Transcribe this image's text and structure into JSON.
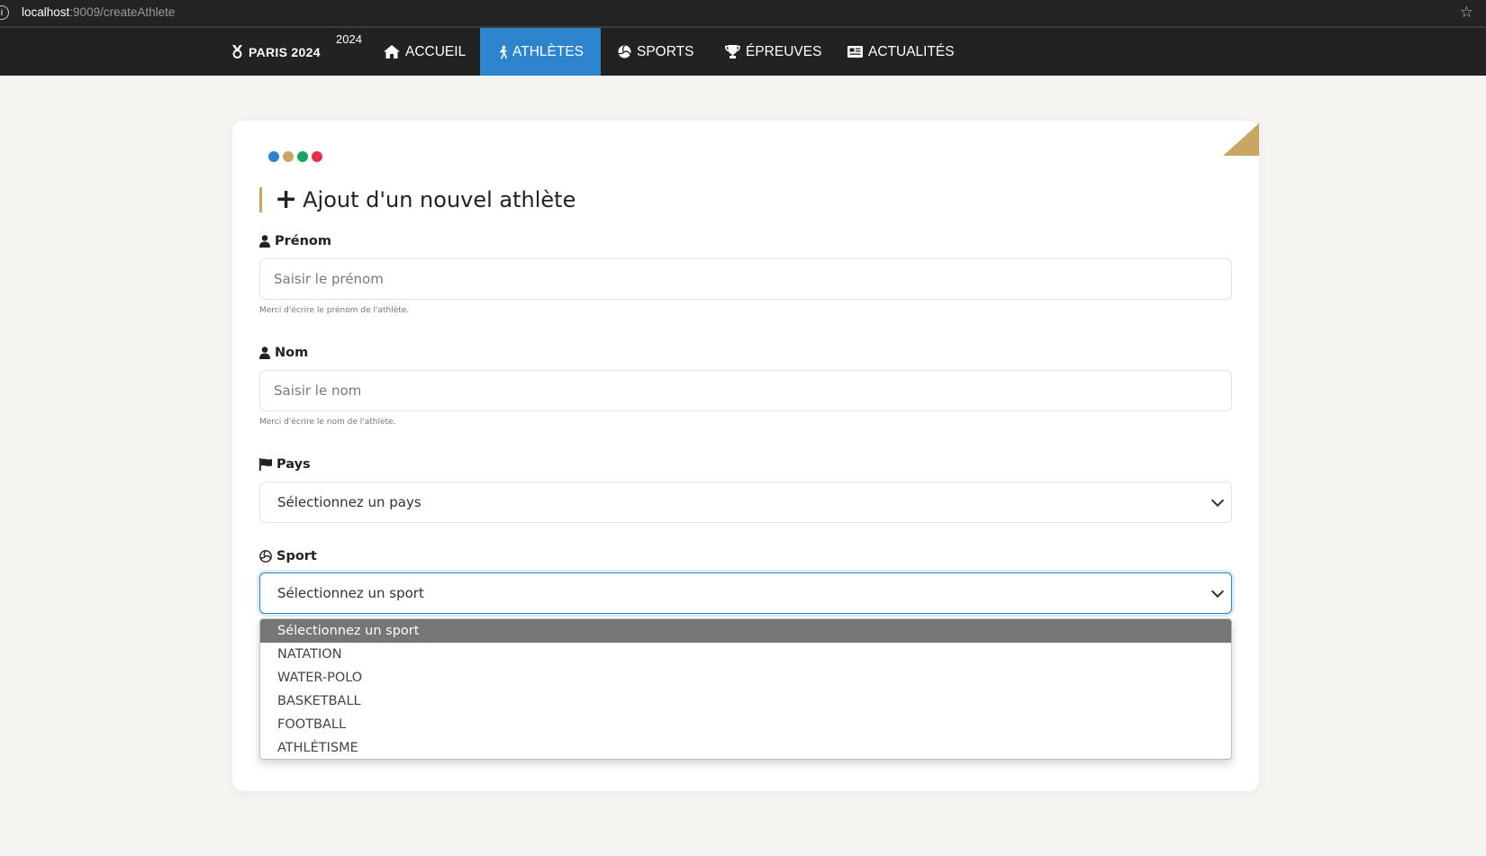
{
  "browser": {
    "url_host": "localhost",
    "url_path": ":9009/createAthlete"
  },
  "nav": {
    "brand": "PARIS 2024",
    "brand_year": "2024",
    "items": [
      {
        "label": "ACCUEIL",
        "icon": "home-icon",
        "active": false
      },
      {
        "label": "ATHLÈTES",
        "icon": "running-icon",
        "active": true
      },
      {
        "label": "SPORTS",
        "icon": "volleyball-icon",
        "active": false
      },
      {
        "label": "ÉPREUVES",
        "icon": "trophy-icon",
        "active": false
      },
      {
        "label": "ACTUALITÉS",
        "icon": "newspaper-icon",
        "active": false
      }
    ],
    "active_color": "#2b84cc"
  },
  "form": {
    "title": "Ajout d'un nouvel athlète",
    "dots_colors": [
      "#2b84cc",
      "#c9a661",
      "#1aa260",
      "#e0334a"
    ],
    "accent_color": "#c9a661",
    "prenom": {
      "label": "Prénom",
      "placeholder": "Saisir le prénom",
      "help": "Merci d'écrire le prénom de l'athlète."
    },
    "nom": {
      "label": "Nom",
      "placeholder": "Saisir le nom",
      "help": "Merci d'écrire le nom de l'athlète."
    },
    "pays": {
      "label": "Pays",
      "selected": "Sélectionnez un pays"
    },
    "sport": {
      "label": "Sport",
      "selected": "Sélectionnez un sport",
      "options": [
        "Sélectionnez un sport",
        "NATATION",
        "WATER-POLO",
        "BASKETBALL",
        "FOOTBALL",
        "ATHLÉTISME"
      ]
    }
  }
}
